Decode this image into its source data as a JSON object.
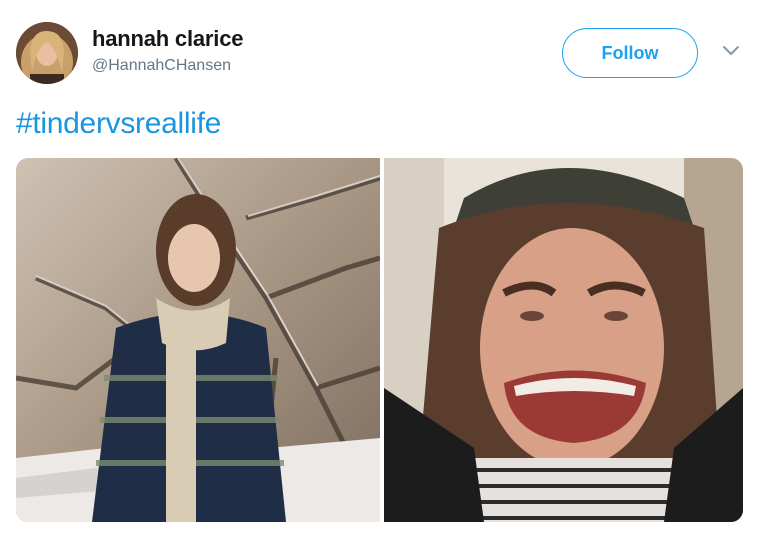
{
  "tweet": {
    "author": {
      "display_name": "hannah clarice",
      "handle": "@HannahCHansen",
      "avatar_icon": "profile-photo"
    },
    "follow_label": "Follow",
    "menu_icon": "chevron-down-icon",
    "text": "#tindervsreallife",
    "media": [
      {
        "kind": "photo",
        "subject": "woman in scarf and striped coat in snowy woods"
      },
      {
        "kind": "photo",
        "subject": "close-up selfie with stretched grin"
      }
    ]
  },
  "colors": {
    "accent": "#1da1f2",
    "hashtag": "#1b95e0",
    "name": "#14171a",
    "handle": "#657786"
  }
}
